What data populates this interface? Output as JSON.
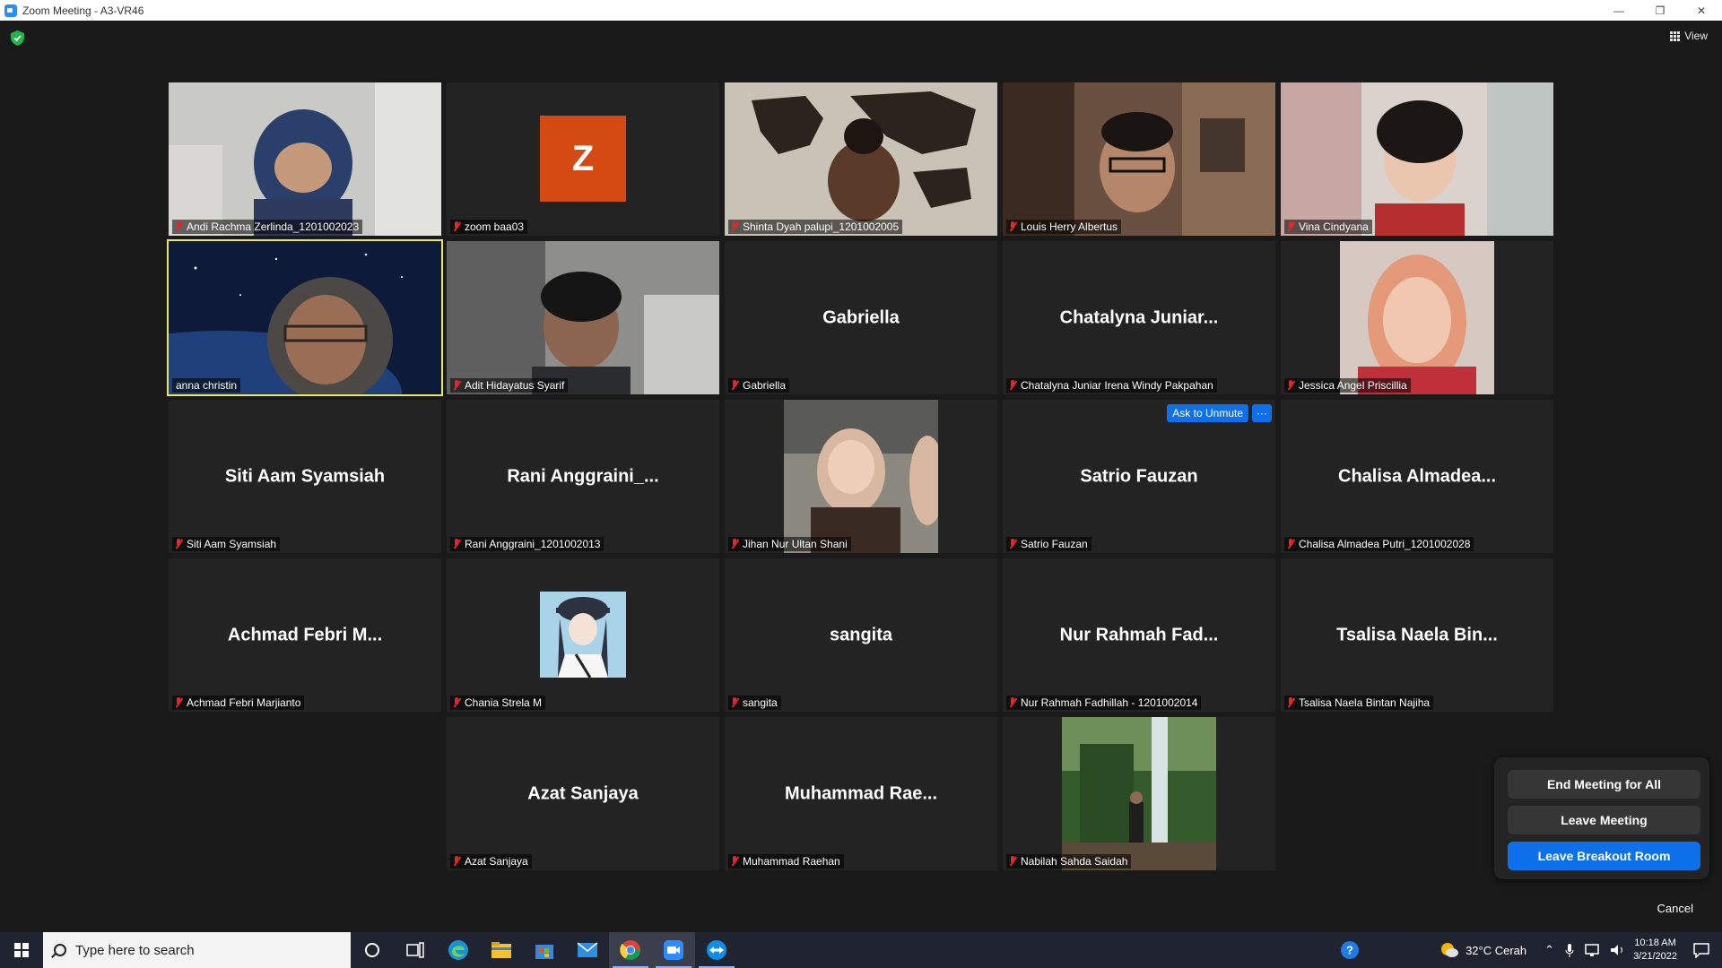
{
  "window": {
    "title": "Zoom Meeting - A3-VR46",
    "controls": [
      "—",
      "❐",
      "✕"
    ]
  },
  "toolbar": {
    "view_label": "View"
  },
  "participants": [
    {
      "name": "Andi Rachma Zerlinda_1201002023",
      "type": "video"
    },
    {
      "name": "zoom baa03",
      "type": "avatar",
      "initial": "Z"
    },
    {
      "name": "Shinta Dyah palupi_1201002005",
      "type": "video"
    },
    {
      "name": "Louis Herry Albertus",
      "type": "video"
    },
    {
      "name": "Vina Cindyana",
      "type": "video"
    },
    {
      "name": "anna christin",
      "type": "video",
      "active_speaker": true
    },
    {
      "name": "Adit Hidayatus Syarif",
      "type": "video"
    },
    {
      "name": "Gabriella",
      "type": "name",
      "display": "Gabriella"
    },
    {
      "name": "Chatalyna Juniar Irena Windy Pakpahan",
      "type": "name",
      "display": "Chatalyna  Juniar..."
    },
    {
      "name": "Jessica Angel Priscillia",
      "type": "video"
    },
    {
      "name": "Siti Aam Syamsiah",
      "type": "name",
      "display": "Siti Aam Syamsiah"
    },
    {
      "name": "Rani Anggraini_1201002013",
      "type": "name",
      "display": "Rani  Anggraini_..."
    },
    {
      "name": "Jihan Nur Ultan Shani",
      "type": "video"
    },
    {
      "name": "Satrio Fauzan",
      "type": "name",
      "display": "Satrio Fauzan",
      "ask_to_unmute": "Ask to Unmute",
      "more": "···"
    },
    {
      "name": "Chalisa Almadea Putri_1201002028",
      "type": "name",
      "display": "Chalisa  Almadea..."
    },
    {
      "name": "Achmad Febri Marjianto",
      "type": "name",
      "display": "Achmad  Febri  M..."
    },
    {
      "name": "Chania Strela M",
      "type": "avatar-image"
    },
    {
      "name": "sangita",
      "type": "name",
      "display": "sangita"
    },
    {
      "name": "Nur Rahmah Fadhillah - 1201002014",
      "type": "name",
      "display": "Nur  Rahmah  Fad..."
    },
    {
      "name": "Tsalisa Naela Bintan Najiha",
      "type": "name",
      "display": "Tsalisa  Naela  Bin..."
    },
    {
      "name": "Azat Sanjaya",
      "type": "name",
      "display": "Azat Sanjaya"
    },
    {
      "name": "Muhammad Raehan",
      "type": "name",
      "display": "Muhammad  Rae..."
    },
    {
      "name": "Nabilah Sahda Saidah",
      "type": "video"
    }
  ],
  "leave_panel": {
    "end_all": "End Meeting for All",
    "leave": "Leave Meeting",
    "leave_breakout": "Leave Breakout Room",
    "cancel": "Cancel"
  },
  "taskbar": {
    "search_placeholder": "Type here to search",
    "weather": "32°C  Cerah",
    "time": "10:18 AM",
    "date": "3/21/2022"
  },
  "colors": {
    "active_speaker": "#e8e85a",
    "primary_blue": "#0e71eb",
    "muted_red": "#e02828"
  }
}
